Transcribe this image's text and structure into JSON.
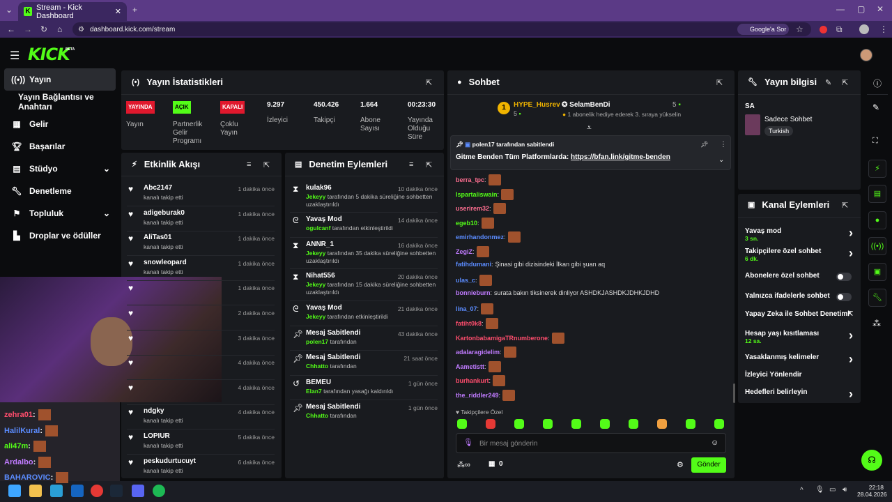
{
  "browser": {
    "tab_title": "Stream - Kick Dashboard",
    "url": "dashboard.kick.com/stream",
    "google_btn": "Google'a Sor"
  },
  "brand": {
    "logo": "KICK",
    "beta": "BETA",
    "accent": "#53fc18"
  },
  "sidebar": {
    "items": [
      {
        "label": "Yayın",
        "icon": "broadcast-icon"
      },
      {
        "label": "Yayın Bağlantısı ve Anahtarı",
        "icon": ""
      },
      {
        "label": "Gelir",
        "icon": "chart-icon"
      },
      {
        "label": "Başarılar",
        "icon": "trophy-icon"
      },
      {
        "label": "Stüdyo",
        "icon": "studio-icon"
      },
      {
        "label": "Denetleme",
        "icon": "wrench-icon"
      },
      {
        "label": "Topluluk",
        "icon": "community-icon"
      },
      {
        "label": "Droplar ve ödüller",
        "icon": "gift-icon"
      }
    ]
  },
  "stats": {
    "title": "Yayın İstatistikleri",
    "items": [
      {
        "badge": "YAYINDA",
        "label": "Yayın"
      },
      {
        "badge": "AÇIK",
        "label": "Partnerlik Gelir Programı"
      },
      {
        "badge": "KAPALI",
        "label": "Çoklu Yayın"
      },
      {
        "value": "9.297",
        "label": "İzleyici"
      },
      {
        "value": "450.426",
        "label": "Takipçi"
      },
      {
        "value": "1.664",
        "label": "Abone Sayısı"
      },
      {
        "value": "00:23:30",
        "label": "Yayında Olduğu Süre"
      }
    ]
  },
  "activity": {
    "title": "Etkinlik Akışı",
    "items": [
      {
        "name": "Abc2147",
        "sub": "kanalı takip etti",
        "time": "1 dakika önce"
      },
      {
        "name": "adigeburak0",
        "sub": "kanalı takip etti",
        "time": "1 dakika önce"
      },
      {
        "name": "AliTas01",
        "sub": "kanalı takip etti",
        "time": "1 dakika önce"
      },
      {
        "name": "snowleopard",
        "sub": "kanalı takip etti",
        "time": "1 dakika önce"
      },
      {
        "name": "",
        "sub": "",
        "time": "1 dakika önce"
      },
      {
        "name": "",
        "sub": "",
        "time": "2 dakika önce"
      },
      {
        "name": "",
        "sub": "",
        "time": "3 dakika önce"
      },
      {
        "name": "",
        "sub": "",
        "time": "4 dakika önce"
      },
      {
        "name": "",
        "sub": "",
        "time": "4 dakika önce"
      },
      {
        "name": "ndgky",
        "sub": "kanalı takip etti",
        "time": "4 dakika önce"
      },
      {
        "name": "LOPIUR",
        "sub": "kanalı takip etti",
        "time": "5 dakika önce"
      },
      {
        "name": "peskudurtucuyt",
        "sub": "kanalı takip etti",
        "time": "6 dakika önce"
      }
    ]
  },
  "moderation": {
    "title": "Denetim Eylemleri",
    "items": [
      {
        "name": "kulak96",
        "user": "Jekeyy",
        "sub": "tarafından 5 dakika süreliğine sohbetten uzaklaştırıldı",
        "time": "10 dakika önce",
        "icon": "hourglass-icon"
      },
      {
        "name": "Yavaş Mod",
        "user": "ogulcanf",
        "sub": "tarafından etkinleştirildi",
        "time": "14 dakika önce",
        "icon": "snail-icon"
      },
      {
        "name": "ANNR_1",
        "user": "Jekeyy",
        "sub": "tarafından 35 dakika süreliğine sohbetten uzaklaştırıldı",
        "time": "16 dakika önce",
        "icon": "hourglass-icon"
      },
      {
        "name": "Nihat556",
        "user": "Jekeyy",
        "sub": "tarafından 15 dakika süreliğine sohbetten uzaklaştırıldı",
        "time": "20 dakika önce",
        "icon": "hourglass-icon"
      },
      {
        "name": "Yavaş Mod",
        "user": "Jekeyy",
        "sub": "tarafından etkinleştirildi",
        "time": "21 dakika önce",
        "icon": "snail-icon"
      },
      {
        "name": "Mesaj Sabitlendi",
        "user": "polen17",
        "sub": "tarafından",
        "time": "43 dakika önce",
        "icon": "pin-icon"
      },
      {
        "name": "Mesaj Sabitlendi",
        "user": "Chhatto",
        "sub": "tarafından",
        "time": "21 saat önce",
        "icon": "pin-icon"
      },
      {
        "name": "BEMEU",
        "user": "Elan7",
        "sub": "tarafından yasağı kaldırıldı",
        "time": "1 gün önce",
        "icon": "undo-icon"
      },
      {
        "name": "Mesaj Sabitlendi",
        "user": "Chhatto",
        "sub": "tarafından",
        "time": "1 gün önce",
        "icon": "pin-icon"
      }
    ]
  },
  "chat": {
    "title": "Sohbet",
    "top_gifter": {
      "rank": "1",
      "name": "HYPE_Husrev",
      "count": "5"
    },
    "gift_event": {
      "name": "SelamBenDi",
      "count": "5",
      "text": "1 abonelik hediye ederek 3. sıraya yükselin"
    },
    "pinned": {
      "by": "polen17",
      "by_text": "tarafından sabitlendi",
      "message": "Gitme Benden Tüm Platformlarda:",
      "link": "https://bfan.link/gitme-benden"
    },
    "messages": [
      {
        "user": "berra_tpc",
        "color": "#ff6f91",
        "text": ""
      },
      {
        "user": "Ispartaliswain",
        "color": "#53fc18",
        "text": ""
      },
      {
        "user": "userirem32",
        "color": "#ff6f91",
        "text": ""
      },
      {
        "user": "egeb10",
        "color": "#53fc18",
        "text": ""
      },
      {
        "user": "emirhandonmez",
        "color": "#5b8cff",
        "text": ""
      },
      {
        "user": "ZegiZ",
        "color": "#c07bff",
        "text": ""
      },
      {
        "user": "fatihdumani",
        "color": "#5b8cff",
        "text": "Şinasi gibi dizisindeki İlkan gibi şuan aq"
      },
      {
        "user": "ulas_c",
        "color": "#5b8cff",
        "text": ""
      },
      {
        "user": "bonnieburn",
        "color": "#c07bff",
        "text": "surata bakın tiksinerek dinliyor ASHDKJASHDKJDHKJDHD"
      },
      {
        "user": "lina_07",
        "color": "#5b8cff",
        "text": ""
      },
      {
        "user": "fatiht0k8",
        "color": "#ff4d6d",
        "text": ""
      },
      {
        "user": "KartonbabamigaTRnumberone",
        "color": "#ff4d6d",
        "text": ""
      },
      {
        "user": "adalaragidelim",
        "color": "#c07bff",
        "text": ""
      },
      {
        "user": "Aametistt",
        "color": "#c07bff",
        "text": ""
      },
      {
        "user": "burhankurt",
        "color": "#ff4d6d",
        "text": ""
      },
      {
        "user": "the_riddler249",
        "color": "#c07bff",
        "text": ""
      }
    ],
    "followers_only": "Takipçilere Özel",
    "input_placeholder": "Bir mesaj gönderin",
    "send": "Gönder",
    "points": "0"
  },
  "info": {
    "title": "Yayın bilgisi",
    "stream_title": "SA",
    "category": "Sadece Sohbet",
    "tag": "Turkish"
  },
  "channel_actions": {
    "title": "Kanal Eylemleri",
    "items": [
      {
        "label": "Yavaş mod",
        "sub": "3 sn.",
        "control": "arrow"
      },
      {
        "label": "Takipçilere özel sohbet",
        "sub": "6 dk.",
        "control": "arrow"
      },
      {
        "label": "Abonelere özel sohbet",
        "sub": "",
        "control": "toggle"
      },
      {
        "label": "Yalnızca ifadelerle sohbet",
        "sub": "",
        "control": "toggle"
      },
      {
        "label": "Yapay Zeka ile Sohbet Denetimi",
        "sub": "",
        "control": "external"
      },
      {
        "label": "Hesap yaşı kısıtlaması",
        "sub": "12 sa.",
        "control": "arrow"
      },
      {
        "label": "Yasaklanmış kelimeler",
        "sub": "",
        "control": "arrow"
      },
      {
        "label": "İzleyici Yönlendir",
        "sub": "",
        "control": ""
      },
      {
        "label": "Hedefleri belirleyin",
        "sub": "",
        "control": "arrow"
      }
    ]
  },
  "overlay_chat": [
    {
      "user": "zehra01",
      "color": "#ff4d6d"
    },
    {
      "user": "HalilKural",
      "color": "#5b8cff"
    },
    {
      "user": "ali47m",
      "color": "#53fc18"
    },
    {
      "user": "Ardalbo",
      "color": "#c07bff"
    },
    {
      "user": "BAHAROVIC",
      "color": "#5b8cff"
    }
  ],
  "taskbar": {
    "time": "22:18",
    "date": "28.04.2026"
  }
}
